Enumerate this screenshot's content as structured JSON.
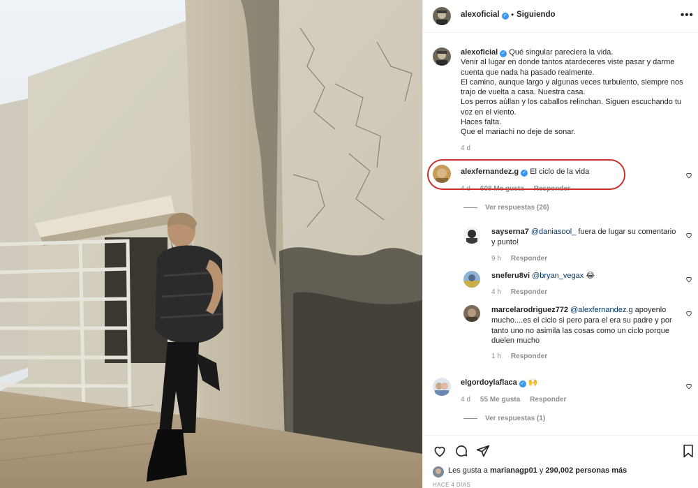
{
  "post": {
    "username": "alexoficial",
    "follow_status": "Siguiendo",
    "separator": "•",
    "more_label": "•••",
    "caption_lines": [
      "Qué singular pareciera la vida.",
      "Venir al lugar en donde tantos atardeceres viste pasar y darme cuenta que nada ha pasado realmente.",
      "El camino, aunque largo y algunas veces turbulento, siempre nos trajo de vuelta a casa. Nuestra casa.",
      "Los perros aúllan y los caballos relinchan. Siguen escuchando tu voz en el viento.",
      "Haces falta.",
      "Que el mariachi no deje de sonar."
    ],
    "caption_time": "4 d",
    "verified_mark": "✓"
  },
  "comments": [
    {
      "username": "alexfernandez.g",
      "verified": true,
      "text": "El ciclo de la vida",
      "time": "4 d",
      "likes": "608 Me gusta",
      "reply_label": "Responder",
      "view_replies": "Ver respuestas (26)"
    },
    {
      "username": "sayserna7",
      "mention": "@daniasool_",
      "text": " fuera de lugar su comentario y punto!",
      "time": "9 h",
      "reply_label": "Responder"
    },
    {
      "username": "sneferu8vi",
      "mention": "@bryan_vegax",
      "text": " 😂",
      "time": "4 h",
      "reply_label": "Responder"
    },
    {
      "username": "marcelarodriguez772",
      "mention": "@alexfernandez.g",
      "text": " apoyenlo mucho....es el ciclo si pero para el era su padre y por tanto uno no asimila las cosas como un ciclo porque duelen mucho",
      "time": "1 h",
      "reply_label": "Responder"
    },
    {
      "username": "elgordoylaflaca",
      "verified": true,
      "text": "🙌",
      "time": "4 d",
      "likes": "55 Me gusta",
      "reply_label": "Responder",
      "view_replies": "Ver respuestas (1)"
    }
  ],
  "footer": {
    "likes_prefix": "Les gusta a ",
    "likes_user": "marianagp01",
    "likes_mid": " y ",
    "likes_count": "290,002 personas más",
    "posted_ago": "HACE 4 DÍAS"
  },
  "icons": [
    "heart-icon",
    "comment-icon",
    "share-icon",
    "bookmark-icon",
    "verified-icon",
    "more-icon"
  ],
  "colors": {
    "accent_blue": "#3897f0",
    "mention": "#00376b",
    "highlight_ring": "#c9302c",
    "muted": "#8e8e8e"
  }
}
